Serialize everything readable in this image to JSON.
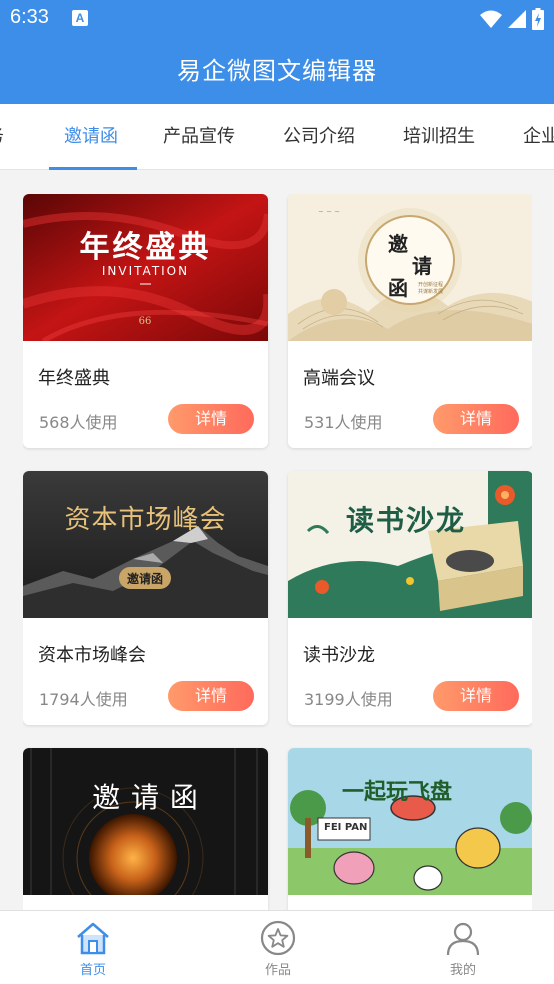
{
  "status": {
    "time": "6:33",
    "notif_letter": "A"
  },
  "header": {
    "title": "易企微图文编辑器"
  },
  "tabs": [
    {
      "label": "务"
    },
    {
      "label": "邀请函",
      "active": true
    },
    {
      "label": "产品宣传"
    },
    {
      "label": "公司介绍"
    },
    {
      "label": "培训招生"
    },
    {
      "label": "企业"
    }
  ],
  "cards": [
    {
      "title": "年终盛典",
      "usage": "568人使用",
      "button": "详情",
      "thumb": {
        "main": "年终盛典",
        "sub": "INVITATION"
      }
    },
    {
      "title": "高端会议",
      "usage": "531人使用",
      "button": "详情",
      "thumb": {
        "chars": [
          "邀",
          "请",
          "函"
        ]
      }
    },
    {
      "title": "资本市场峰会",
      "usage": "1794人使用",
      "button": "详情",
      "thumb": {
        "main": "资本市场峰会",
        "badge": "邀请函"
      }
    },
    {
      "title": "读书沙龙",
      "usage": "3199人使用",
      "button": "详情",
      "thumb": {
        "main": "读书沙龙"
      }
    },
    {
      "title": "",
      "usage": "",
      "button": "",
      "thumb": {
        "main": "邀 请 函"
      }
    },
    {
      "title": "",
      "usage": "",
      "button": "",
      "thumb": {
        "main": "一起玩飞盘",
        "sign": "FEI PAN"
      }
    }
  ],
  "bottom_nav": [
    {
      "label": "首页",
      "icon": "home-icon",
      "active": true
    },
    {
      "label": "作品",
      "icon": "star-icon"
    },
    {
      "label": "我的",
      "icon": "person-icon"
    }
  ],
  "colors": {
    "primary": "#3d8ee8",
    "button_gradient_start": "#ff9a6b",
    "button_gradient_end": "#ff6a5c"
  }
}
